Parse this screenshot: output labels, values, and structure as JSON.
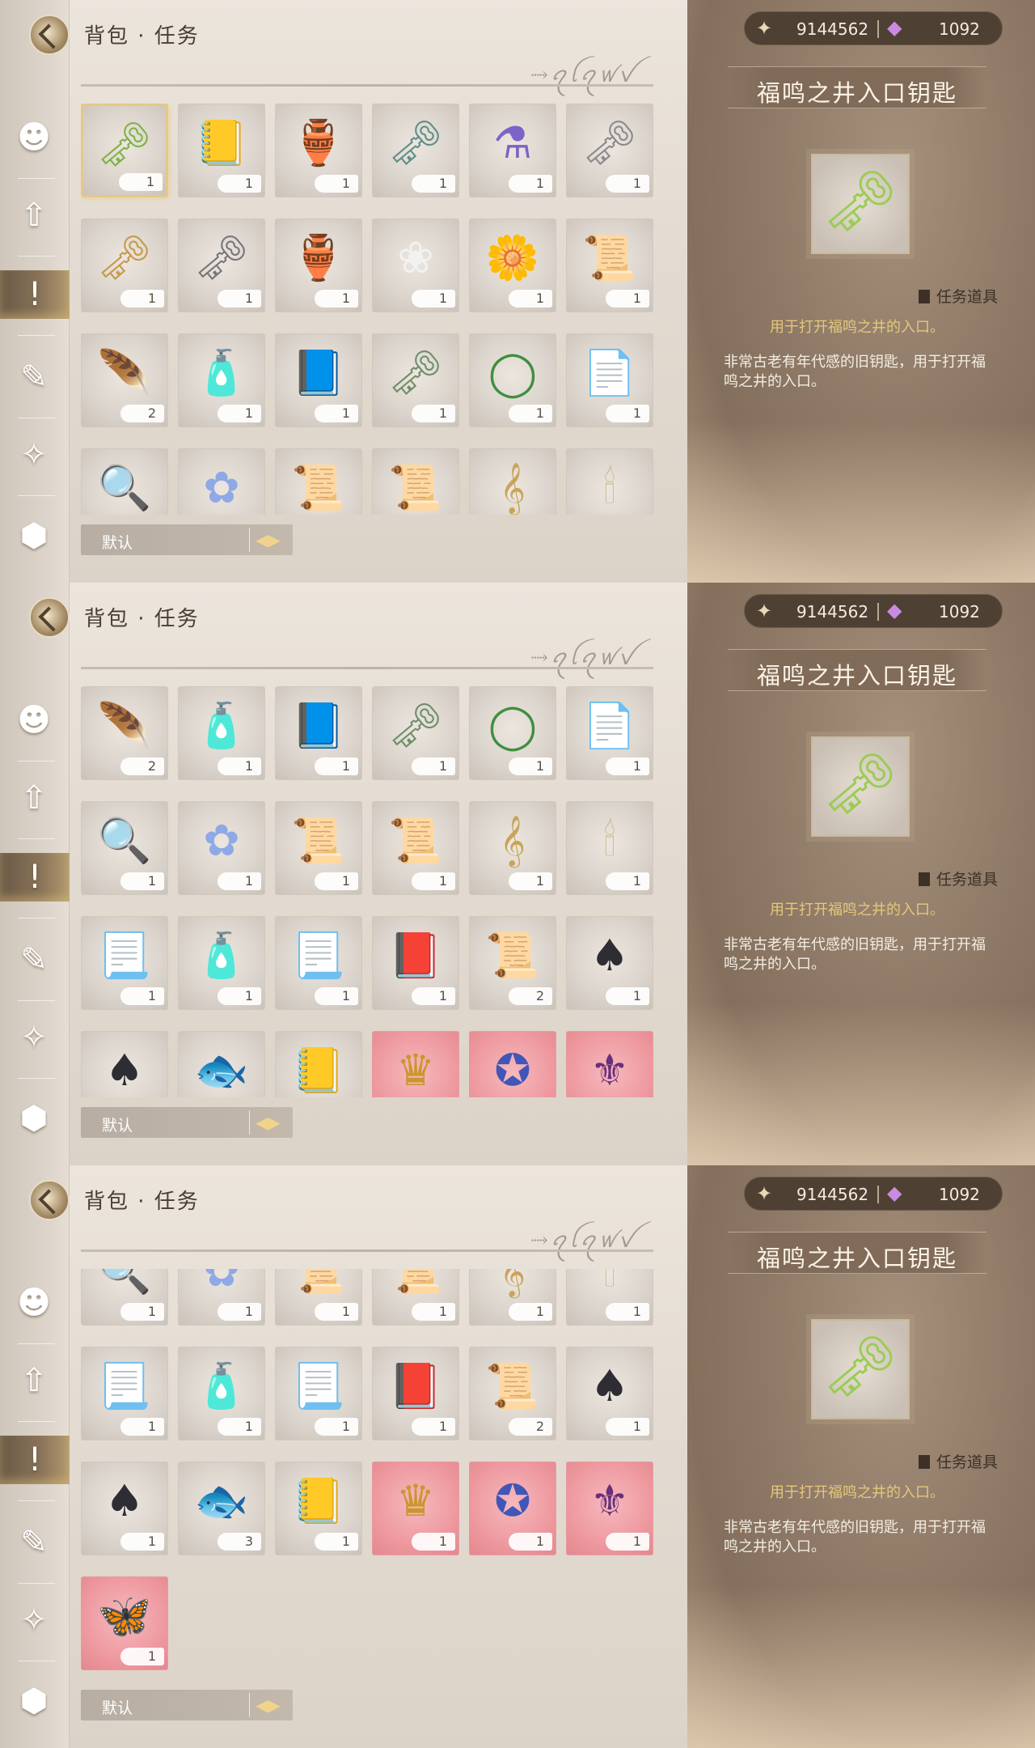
{
  "ui": {
    "title": "背包 · 任务",
    "deco_script": "⤑ꪖꪶꪖꪝꪜ",
    "sort_label": "默认",
    "sort_icon": "◀▶",
    "currency": {
      "gold_icon": "✦",
      "gold": "9144562",
      "gem_icon": "◆",
      "gems": "1092"
    },
    "detail": {
      "name": "福鸣之井入口钥匙",
      "preview_icon": "key-green",
      "type_label": "任务道具",
      "short_desc": "用于打开福鸣之井的入口。",
      "long_desc": "非常古老有年代感的旧钥匙，用于打开福鸣之井的入口。"
    },
    "sidebar_icons": [
      "clothes-icon",
      "upgrade-icon",
      "quest-icon",
      "crystal-icon",
      "star-icon",
      "box-icon"
    ]
  },
  "inventory": [
    {
      "name": "green-key",
      "glyph": "🗝",
      "qty": "1",
      "color": "#7fb347"
    },
    {
      "name": "yellow-book",
      "glyph": "📒",
      "qty": "1",
      "color": "#d8b766"
    },
    {
      "name": "scroll-jar",
      "glyph": "🏺",
      "qty": "1",
      "color": "#9a6b45"
    },
    {
      "name": "ornate-key",
      "glyph": "🗝",
      "qty": "1",
      "color": "#5f8f8a"
    },
    {
      "name": "purple-potion",
      "glyph": "⚗",
      "qty": "1",
      "color": "#7a64c8"
    },
    {
      "name": "silver-key",
      "glyph": "🗝",
      "qty": "1",
      "color": "#8a8a8e"
    },
    {
      "name": "gold-key",
      "glyph": "🗝",
      "qty": "1",
      "color": "#c79a4a"
    },
    {
      "name": "iron-key",
      "glyph": "🗝",
      "qty": "1",
      "color": "#77767a"
    },
    {
      "name": "wood-lantern",
      "glyph": "🏺",
      "qty": "1",
      "color": "#a67a52"
    },
    {
      "name": "white-flower",
      "glyph": "❀",
      "qty": "1",
      "color": "#f2f2f0"
    },
    {
      "name": "yellow-rose",
      "glyph": "🌼",
      "qty": "1",
      "color": "#e8c43a"
    },
    {
      "name": "letter",
      "glyph": "📜",
      "qty": "1",
      "color": "#d49a7a"
    },
    {
      "name": "blue-feather",
      "glyph": "🪶",
      "qty": "2",
      "color": "#8fa6e8"
    },
    {
      "name": "blue-potion",
      "glyph": "🧴",
      "qty": "1",
      "color": "#5fb0e6"
    },
    {
      "name": "blue-tome",
      "glyph": "📘",
      "qty": "1",
      "color": "#6f86c4"
    },
    {
      "name": "teal-key",
      "glyph": "🗝",
      "qty": "1",
      "color": "#6f8f6a"
    },
    {
      "name": "jade-ring",
      "glyph": "◯",
      "qty": "1",
      "color": "#3f8f3f"
    },
    {
      "name": "grey-document",
      "glyph": "📄",
      "qty": "1",
      "color": "#7c7874"
    },
    {
      "name": "hand-mirror",
      "glyph": "🔍",
      "qty": "1",
      "color": "#9c7b52"
    },
    {
      "name": "flower-crown",
      "glyph": "✿",
      "qty": "1",
      "color": "#8fa9e6"
    },
    {
      "name": "dark-scroll-1",
      "glyph": "📜",
      "qty": "1",
      "color": "#3e5158"
    },
    {
      "name": "dark-scroll-2",
      "glyph": "📜",
      "qty": "1",
      "color": "#3e5158"
    },
    {
      "name": "music-note",
      "glyph": "𝄞",
      "qty": "1",
      "color": "#c8a45a"
    },
    {
      "name": "candelabra",
      "glyph": "🕯",
      "qty": "1",
      "color": "#c9b585"
    },
    {
      "name": "paper-note-1",
      "glyph": "📃",
      "qty": "1",
      "color": "#e8e6e2"
    },
    {
      "name": "blue-potion-2",
      "glyph": "🧴",
      "qty": "1",
      "color": "#5fb0e6"
    },
    {
      "name": "paper-note-2",
      "glyph": "📃",
      "qty": "1",
      "color": "#dedcd8"
    },
    {
      "name": "red-book",
      "glyph": "📕",
      "qty": "1",
      "color": "#b0563e"
    },
    {
      "name": "certificate",
      "glyph": "📜",
      "qty": "2",
      "color": "#e9b7a8"
    },
    {
      "name": "black-card",
      "glyph": "♠",
      "qty": "1",
      "color": "#2d2d33"
    },
    {
      "name": "black-card-2",
      "glyph": "♠",
      "qty": "1",
      "color": "#2d2d33"
    },
    {
      "name": "fairy-fish",
      "glyph": "🐟",
      "qty": "3",
      "color": "#9b7ad8"
    },
    {
      "name": "yellow-book-2",
      "glyph": "📒",
      "qty": "1",
      "color": "#e5c97a"
    },
    {
      "name": "gold-lyre-emblem",
      "glyph": "♛",
      "qty": "1",
      "color": "#c9962f",
      "rarity": "red"
    },
    {
      "name": "blue-crest-emblem",
      "glyph": "✪",
      "qty": "1",
      "color": "#4056b8",
      "rarity": "red"
    },
    {
      "name": "purple-crest-emblem",
      "glyph": "⚜",
      "qty": "1",
      "color": "#6a2f7a",
      "rarity": "red"
    },
    {
      "name": "butterfly-emblem",
      "glyph": "🦋",
      "qty": "1",
      "color": "#3f9a8c",
      "rarity": "red"
    }
  ]
}
